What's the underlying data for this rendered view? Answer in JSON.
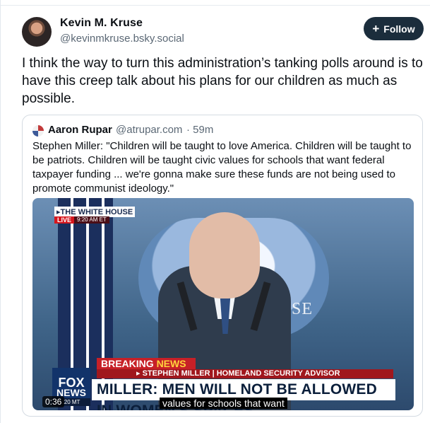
{
  "post": {
    "author_name": "Kevin M. Kruse",
    "author_handle": "@kevinmkruse.bsky.social",
    "follow_label": "Follow",
    "text": "I think the way to turn this administration’s tanking polls around is to have this creep talk about his plans for our children as much as possible."
  },
  "quote": {
    "author_name": "Aaron Rupar",
    "author_handle": "@atrupar.com",
    "time": "· 59m",
    "text": "Stephen Miller: \"Children will be taught to love America. Children will be taught to be patriots. Children will be taught civic values for schools that want federal taxpayer funding ... we're gonna make sure these funds are not being used to promote communist ideology.\""
  },
  "video": {
    "location_label": "THE WHITE HOUSE",
    "live_label": "LIVE",
    "live_time": "9:20 AM ET",
    "house_text": "HOUSE",
    "fox_line1": "FOX",
    "fox_line2": "NEWS",
    "fox_time": ":20 MT",
    "breaking_prefix": "BREAKING ",
    "breaking_news": "NEWS",
    "sub_line": "STEPHEN MILLER | HOMELAND SECURITY ADVISOR",
    "headline": "MILLER: MEN WILL NOT BE ALLOWED IN WOMEN'S SPACES",
    "duration": "0:36",
    "caption": "values for schools that want"
  }
}
